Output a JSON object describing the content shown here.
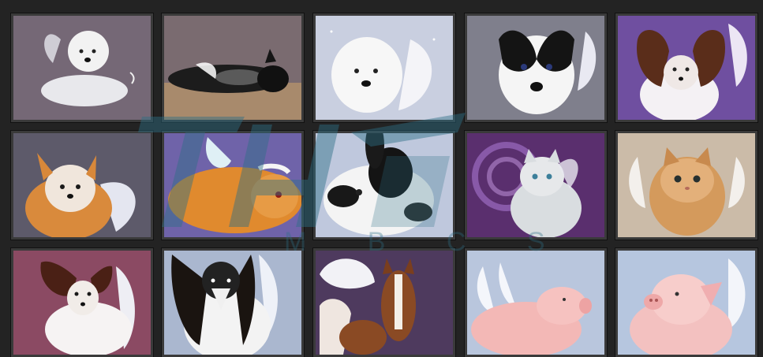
{
  "gallery": {
    "tiles": [
      {
        "subject": "westie-angel-puppy",
        "bg": "#756876"
      },
      {
        "subject": "black-dog-angel-sleeping",
        "bg": "#7a6b70"
      },
      {
        "subject": "westie-angel-snow",
        "bg": "#c9cfe0"
      },
      {
        "subject": "black-white-puppy-angel",
        "bg": "#7f7f8c"
      },
      {
        "subject": "papillon-purple",
        "bg": "#6f4fa0"
      },
      {
        "subject": "chihuahua-angel",
        "bg": "#5d5a6a"
      },
      {
        "subject": "guinea-pig-angel",
        "bg": "#6f63a9"
      },
      {
        "subject": "rabbit-angel",
        "bg": "#bfc8dd"
      },
      {
        "subject": "kitten-galaxy",
        "bg": "#5a2f6e"
      },
      {
        "subject": "kitten-angel-beige",
        "bg": "#cbbba8"
      },
      {
        "subject": "papillon-angel-red",
        "bg": "#8b4a63"
      },
      {
        "subject": "papillon-black-white",
        "bg": "#aab7cf"
      },
      {
        "subject": "foal-angel",
        "bg": "#4e3a5e"
      },
      {
        "subject": "piglet-angel-blue",
        "bg": "#b9c6dd"
      },
      {
        "subject": "piglet-angel-smile",
        "bg": "#b6c6df"
      }
    ]
  },
  "watermark": {
    "text": "M B C S"
  }
}
